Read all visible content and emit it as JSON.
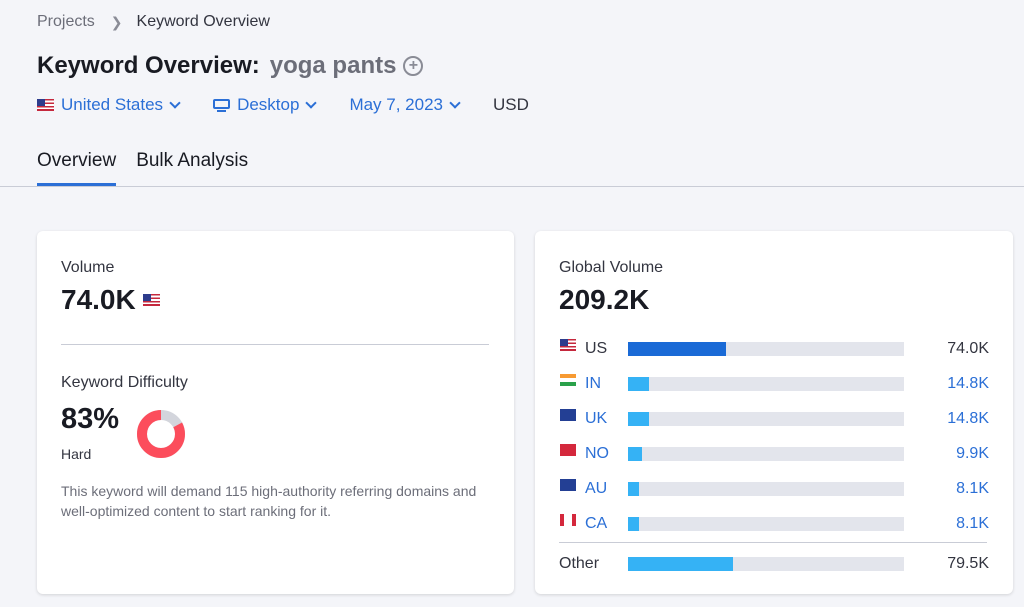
{
  "breadcrumb": {
    "root": "Projects",
    "current": "Keyword Overview"
  },
  "title": {
    "prefix": "Keyword Overview:",
    "keyword": "yoga pants"
  },
  "filters": {
    "country": "United States",
    "device": "Desktop",
    "date": "May 7, 2023",
    "currency": "USD"
  },
  "tabs": [
    {
      "label": "Overview",
      "active": true
    },
    {
      "label": "Bulk Analysis",
      "active": false
    }
  ],
  "volume": {
    "label": "Volume",
    "value": "74.0K"
  },
  "keyword_difficulty": {
    "label": "Keyword Difficulty",
    "value": "83%",
    "percent": 83,
    "level": "Hard",
    "description": "This keyword will demand 115 high-authority referring domains and well-optimized content to start ranking for it.",
    "colors": {
      "fill": "#fc4d5c",
      "track": "#d3d5dc"
    }
  },
  "global_volume": {
    "label": "Global Volume",
    "value": "209.2K",
    "countries": [
      {
        "code": "US",
        "value": "74.0K",
        "fraction": 0.355,
        "flag": "us-flag-icon"
      },
      {
        "code": "IN",
        "value": "14.8K",
        "fraction": 0.075,
        "flag": "in-flag-icon"
      },
      {
        "code": "UK",
        "value": "14.8K",
        "fraction": 0.075,
        "flag": "uk-flag-icon"
      },
      {
        "code": "NO",
        "value": "9.9K",
        "fraction": 0.05,
        "flag": "no-flag-icon"
      },
      {
        "code": "AU",
        "value": "8.1K",
        "fraction": 0.04,
        "flag": "au-flag-icon"
      },
      {
        "code": "CA",
        "value": "8.1K",
        "fraction": 0.04,
        "flag": "ca-flag-icon"
      }
    ],
    "other": {
      "label": "Other",
      "value": "79.5K",
      "fraction": 0.38
    }
  }
}
